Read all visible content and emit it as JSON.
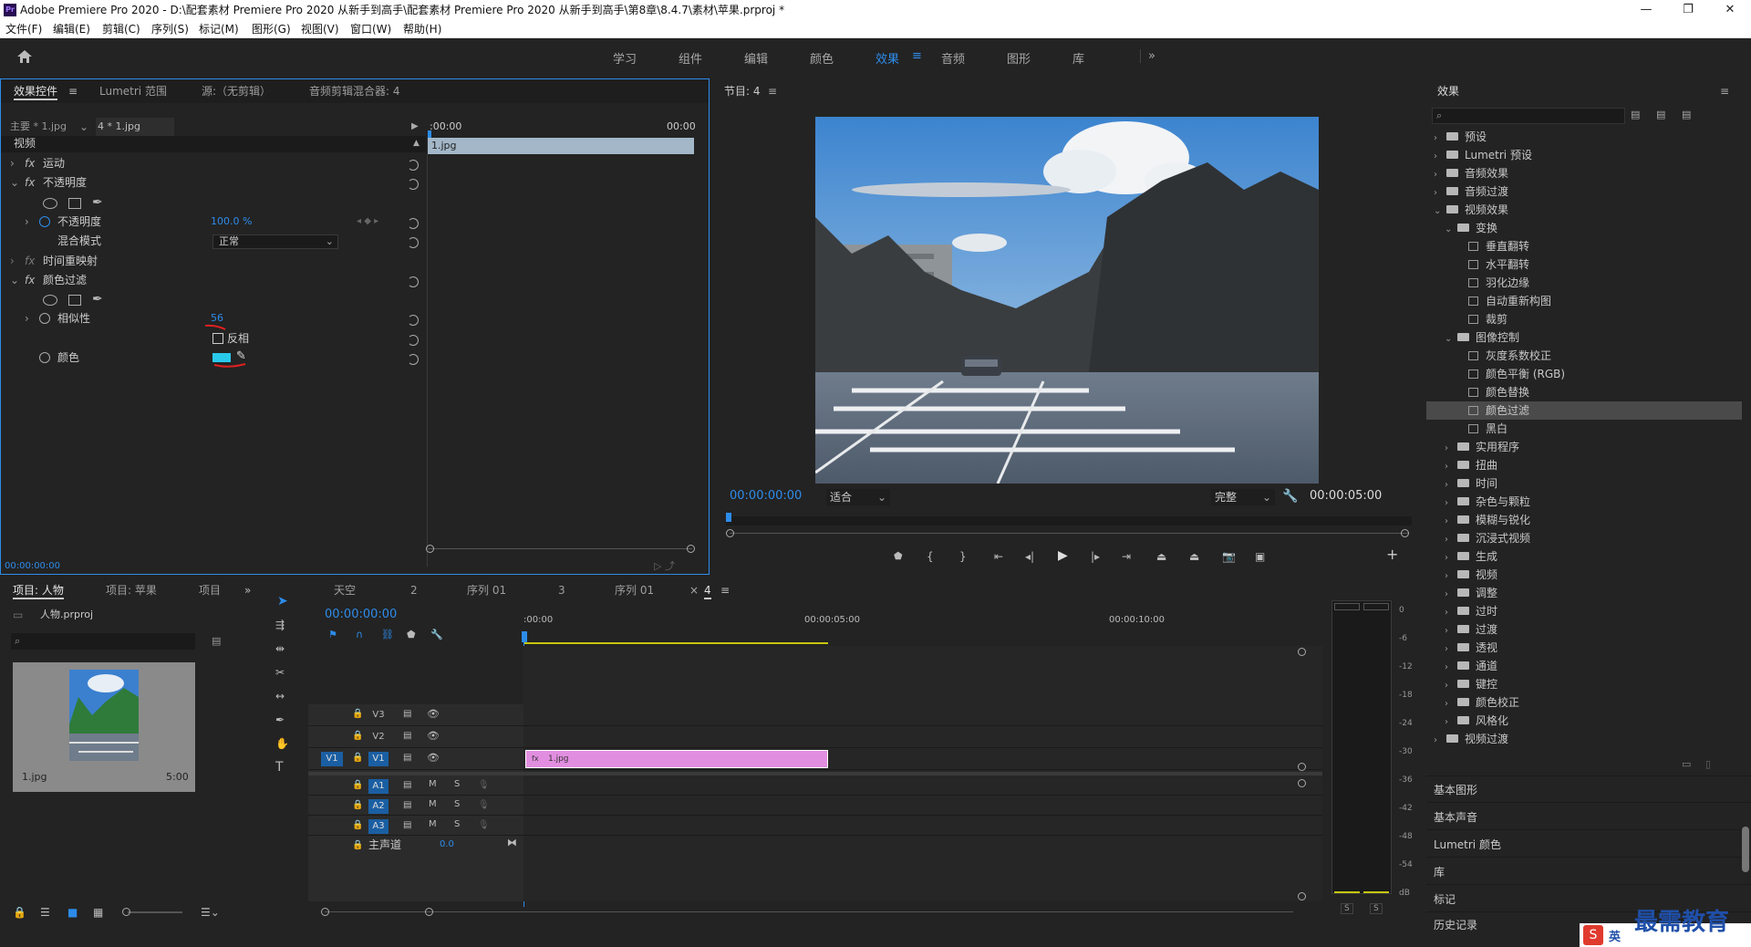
{
  "window": {
    "title": "Adobe Premiere Pro 2020 - D:\\配套素材 Premiere Pro 2020 从新手到高手\\配套素材 Premiere Pro 2020 从新手到高手\\第8章\\8.4.7\\素材\\苹果.prproj *",
    "logo": "Pr",
    "minimize": "—",
    "restore": "❐",
    "close": "✕"
  },
  "menu": [
    "文件(F)",
    "编辑(E)",
    "剪辑(C)",
    "序列(S)",
    "标记(M)",
    "图形(G)",
    "视图(V)",
    "窗口(W)",
    "帮助(H)"
  ],
  "workspaces": [
    "学习",
    "组件",
    "编辑",
    "颜色",
    "效果",
    "音频",
    "图形",
    "库"
  ],
  "workspace_active": "效果",
  "workspace_more": "»",
  "effect_controls": {
    "tabs": [
      "效果控件",
      "Lumetri 范围",
      "源:（无剪辑）",
      "音频剪辑混合器: 4"
    ],
    "tab_menu": "≡",
    "master_label": "主要 * 1.jpg",
    "clip_label": "4 * 1.jpg",
    "time_start": ":00:00",
    "time_end": "00:00",
    "clip_bar": "1.jpg",
    "section_video": "视频",
    "fx_motion": "运动",
    "fx_opacity": "不透明度",
    "opacity_label": "不透明度",
    "opacity_value": "100.0 %",
    "blend_label": "混合模式",
    "blend_value": "正常",
    "time_remap": "时间重映射",
    "fx_color_pass": "颜色过滤",
    "similarity_label": "相似性",
    "similarity_value": "56",
    "invert_label": "反相",
    "color_label": "颜色",
    "swatch_color": "#29c9ec",
    "timecode": "00:00:00:00"
  },
  "program": {
    "title": "节目: 4",
    "menu": "≡",
    "timecode": "00:00:00:00",
    "fit": "适合",
    "quality": "完整",
    "duration": "00:00:05:00"
  },
  "effects_panel": {
    "title": "效果",
    "menu": "≡",
    "search_placeholder": "",
    "tree": [
      {
        "label": "预设",
        "level": 0,
        "type": "folder",
        "open": false
      },
      {
        "label": "Lumetri 预设",
        "level": 0,
        "type": "folder",
        "open": false
      },
      {
        "label": "音频效果",
        "level": 0,
        "type": "folder",
        "open": false
      },
      {
        "label": "音频过渡",
        "level": 0,
        "type": "folder",
        "open": false
      },
      {
        "label": "视频效果",
        "level": 0,
        "type": "folder",
        "open": true
      },
      {
        "label": "变换",
        "level": 1,
        "type": "folder",
        "open": true
      },
      {
        "label": "垂直翻转",
        "level": 2,
        "type": "fx"
      },
      {
        "label": "水平翻转",
        "level": 2,
        "type": "fx"
      },
      {
        "label": "羽化边缘",
        "level": 2,
        "type": "fx"
      },
      {
        "label": "自动重新构图",
        "level": 2,
        "type": "fx"
      },
      {
        "label": "裁剪",
        "level": 2,
        "type": "fx"
      },
      {
        "label": "图像控制",
        "level": 1,
        "type": "folder",
        "open": true
      },
      {
        "label": "灰度系数校正",
        "level": 2,
        "type": "fx"
      },
      {
        "label": "颜色平衡 (RGB)",
        "level": 2,
        "type": "fx"
      },
      {
        "label": "颜色替换",
        "level": 2,
        "type": "fx"
      },
      {
        "label": "颜色过滤",
        "level": 2,
        "type": "fx",
        "selected": true
      },
      {
        "label": "黑白",
        "level": 2,
        "type": "fx"
      },
      {
        "label": "实用程序",
        "level": 1,
        "type": "folder",
        "open": false
      },
      {
        "label": "扭曲",
        "level": 1,
        "type": "folder",
        "open": false
      },
      {
        "label": "时间",
        "level": 1,
        "type": "folder",
        "open": false
      },
      {
        "label": "杂色与颗粒",
        "level": 1,
        "type": "folder",
        "open": false
      },
      {
        "label": "模糊与锐化",
        "level": 1,
        "type": "folder",
        "open": false
      },
      {
        "label": "沉浸式视频",
        "level": 1,
        "type": "folder",
        "open": false
      },
      {
        "label": "生成",
        "level": 1,
        "type": "folder",
        "open": false
      },
      {
        "label": "视频",
        "level": 1,
        "type": "folder",
        "open": false
      },
      {
        "label": "调整",
        "level": 1,
        "type": "folder",
        "open": false
      },
      {
        "label": "过时",
        "level": 1,
        "type": "folder",
        "open": false
      },
      {
        "label": "过渡",
        "level": 1,
        "type": "folder",
        "open": false
      },
      {
        "label": "透视",
        "level": 1,
        "type": "folder",
        "open": false
      },
      {
        "label": "通道",
        "level": 1,
        "type": "folder",
        "open": false
      },
      {
        "label": "键控",
        "level": 1,
        "type": "folder",
        "open": false
      },
      {
        "label": "颜色校正",
        "level": 1,
        "type": "folder",
        "open": false
      },
      {
        "label": "风格化",
        "level": 1,
        "type": "folder",
        "open": false
      },
      {
        "label": "视频过渡",
        "level": 0,
        "type": "folder",
        "open": false
      }
    ],
    "sections": [
      "基本图形",
      "基本声音",
      "Lumetri 颜色",
      "库",
      "标记",
      "历史记录"
    ]
  },
  "project": {
    "tabs": [
      "项目: 人物",
      "项目: 苹果",
      "项目"
    ],
    "more": "»",
    "file": "人物.prproj",
    "thumb_name": "1.jpg",
    "thumb_duration": "5:00"
  },
  "timeline": {
    "tabs": [
      "天空",
      "2",
      "序列 01",
      "3",
      "序列 01",
      "4"
    ],
    "close": "×",
    "menu": "≡",
    "timecode": "00:00:00:00",
    "ruler": [
      ":00:00",
      "00:00:05:00",
      "00:00:10:00"
    ],
    "video_tracks": [
      "V3",
      "V2",
      "V1"
    ],
    "audio_tracks": [
      "A1",
      "A2",
      "A3"
    ],
    "source_patch": "V1",
    "master_label": "主声道",
    "master_value": "0.0",
    "clip_label": "1.jpg",
    "m": "M",
    "s": "S"
  },
  "meter": {
    "labels": [
      "0",
      "-6",
      "-12",
      "-18",
      "-24",
      "-30",
      "-36",
      "-42",
      "-48",
      "-54",
      "dB"
    ],
    "s_left": "S",
    "s_right": "S"
  },
  "watermark": {
    "text": "最需教育",
    "ime": "英"
  }
}
